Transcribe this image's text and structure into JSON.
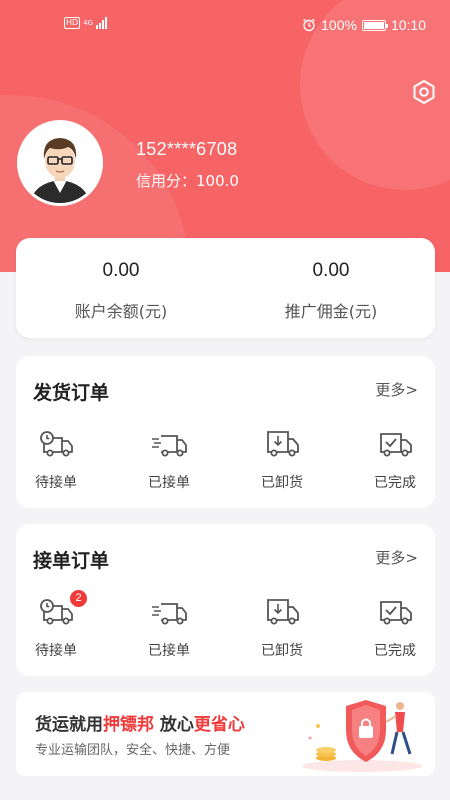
{
  "status_bar": {
    "hd": "HD",
    "network": "4G",
    "battery_percent": "100%",
    "time": "10:10"
  },
  "profile": {
    "phone": "152****6708",
    "credit": "信用分：100.0"
  },
  "balance": {
    "account_value": "0.00",
    "account_label": "账户余额(元)",
    "commission_value": "0.00",
    "commission_label": "推广佣金(元)"
  },
  "shipping_orders": {
    "title": "发货订单",
    "more": "更多>",
    "items": [
      {
        "label": "待接单",
        "icon": "clock-truck-icon"
      },
      {
        "label": "已接单",
        "icon": "moving-truck-icon"
      },
      {
        "label": "已卸货",
        "icon": "unload-truck-icon"
      },
      {
        "label": "已完成",
        "icon": "check-truck-icon"
      }
    ]
  },
  "receiving_orders": {
    "title": "接单订单",
    "more": "更多>",
    "items": [
      {
        "label": "待接单",
        "icon": "clock-truck-icon",
        "badge": "2"
      },
      {
        "label": "已接单",
        "icon": "moving-truck-icon"
      },
      {
        "label": "已卸货",
        "icon": "unload-truck-icon"
      },
      {
        "label": "已完成",
        "icon": "check-truck-icon"
      }
    ]
  },
  "banner": {
    "title_part1": "货运就用",
    "title_brand": "押镖邦",
    "title_part2": " 放心",
    "title_highlight": "更省心",
    "subtitle": "专业运输团队，安全、快捷、方便"
  },
  "colors": {
    "primary": "#f66466",
    "badge": "#ef3b3b",
    "icon": "#555555"
  }
}
